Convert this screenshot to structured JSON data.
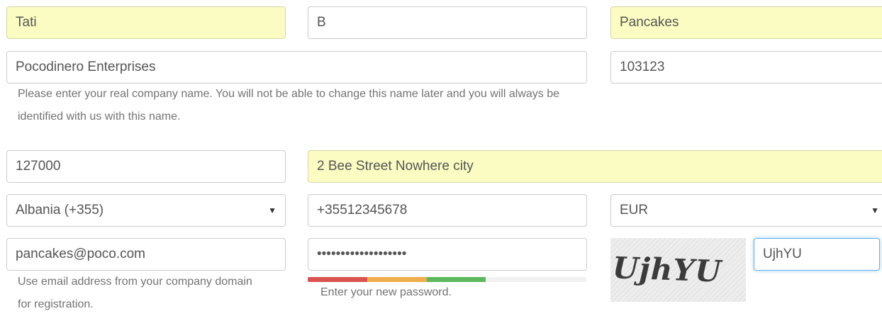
{
  "form": {
    "first_name": "Tati",
    "middle_name": "B",
    "last_name": "Pancakes",
    "company_name": "Pocodinero Enterprises",
    "company_id": "103123",
    "company_help": "Please enter your real company name. You will not be able to change this name later and you will always be identified with us with this name.",
    "postal_code": "127000",
    "address": "2 Bee Street Nowhere city",
    "country": "Albania (+355)",
    "phone": "+35512345678",
    "currency": "EUR",
    "email": "pancakes@poco.com",
    "email_help": "Use email address from your company domain for registration.",
    "password_masked": "•••••••••••••••••••",
    "password_help": "Enter your new password.",
    "password_strength": 0.64,
    "captcha_image_text": "UjhYU",
    "captcha_answer": "UjhYU"
  },
  "icons": {
    "select_arrow": "▼"
  },
  "colors": {
    "autofill_bg": "#fafcc2",
    "strength_weak": "#d9534f",
    "strength_medium": "#f0ad4e",
    "strength_strong": "#5cb85c",
    "focus_border": "#66afe9"
  }
}
